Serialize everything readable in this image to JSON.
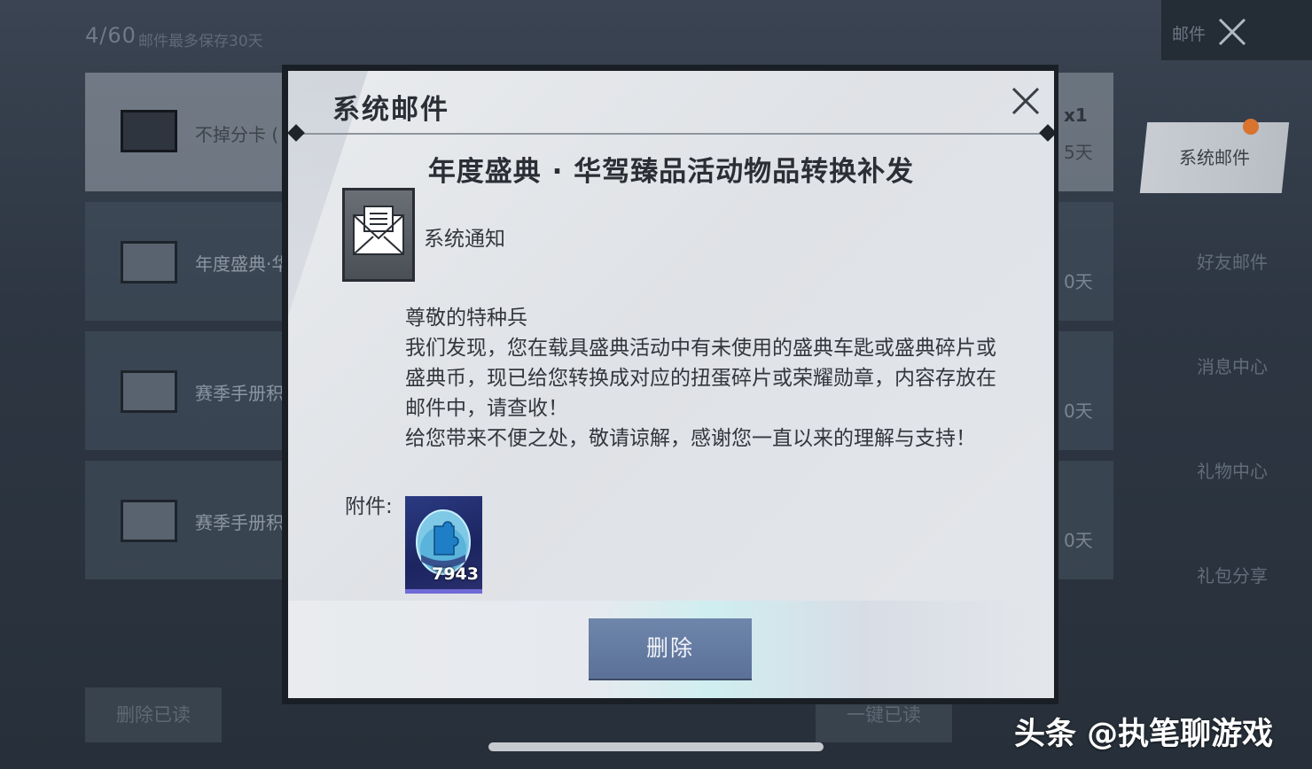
{
  "background": {
    "mail_count": "4/60",
    "mail_note": "邮件最多保存30天",
    "top_right_title": "邮件",
    "list_items": [
      {
        "label": "不掉分卡 (",
        "right_text": "x1"
      },
      {
        "label": "年度盛典·华",
        "right_text": "0天"
      },
      {
        "label": "赛季手册积",
        "right_text": "0天"
      },
      {
        "label": "赛季手册积",
        "right_text": "0天"
      }
    ],
    "first_item_extra": "5天",
    "side_tabs": [
      {
        "label": "系统邮件",
        "active": true,
        "badge": "1"
      },
      {
        "label": "好友邮件",
        "active": false
      },
      {
        "label": "消息中心",
        "active": false
      },
      {
        "label": "礼物中心",
        "active": false
      },
      {
        "label": "礼包分享",
        "active": false
      }
    ],
    "delete_read_label": "删除已读",
    "mark_all_read_label": "一键已读"
  },
  "modal": {
    "title": "系统邮件",
    "subject": "年度盛典 · 华驾臻品活动物品转换补发",
    "sender": "系统通知",
    "body": [
      "尊敬的特种兵",
      "我们发现，您在载具盛典活动中有未使用的盛典车匙或盛典碎片或盛典币，现已给您转换成对应的扭蛋碎片或荣耀勋章，内容存放在邮件中，请查收！",
      "给您带来不便之处，敬请谅解，感谢您一直以来的理解与支持！"
    ],
    "attachment_label": "附件:",
    "attachment": {
      "icon": "puzzle-egg-icon",
      "count": "7943"
    },
    "delete_label": "删除"
  },
  "watermark": "头条 @执笔聊游戏",
  "colors": {
    "accent_button": "#5b7198",
    "badge": "#d8742e"
  }
}
